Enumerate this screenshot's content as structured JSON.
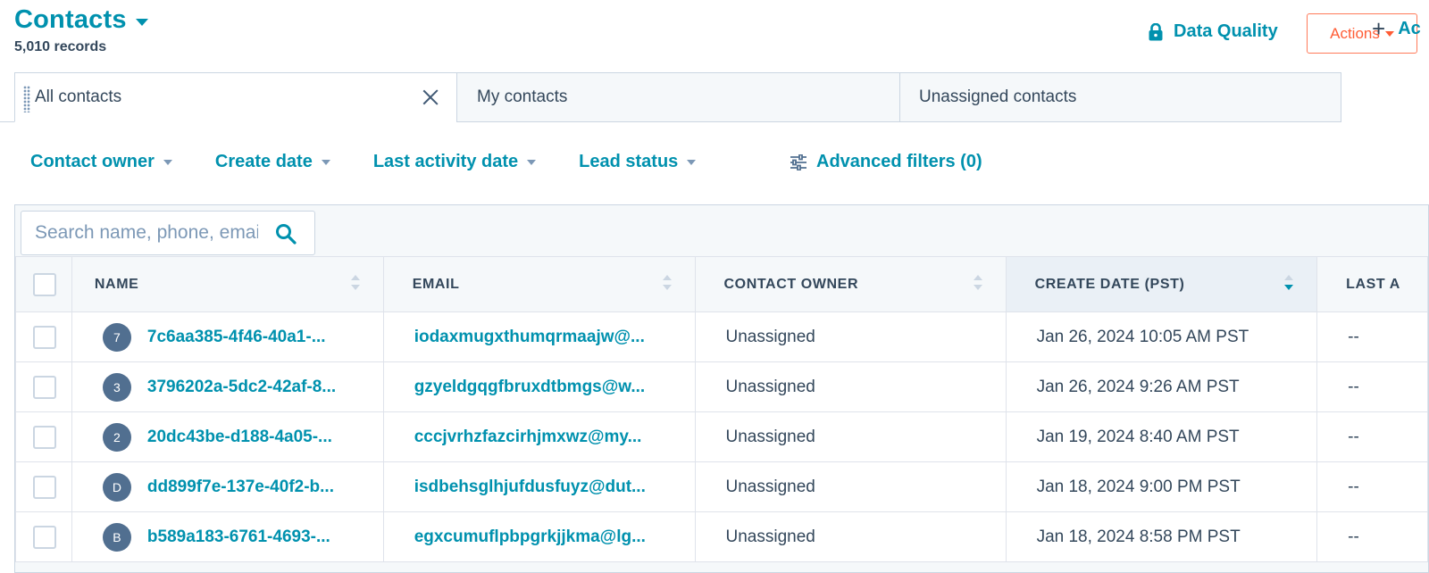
{
  "header": {
    "title": "Contacts",
    "record_count": "5,010 records",
    "data_quality_label": "Data Quality",
    "actions_label": "Actions"
  },
  "tabs": [
    {
      "label": "All contacts",
      "active": true
    },
    {
      "label": "My contacts",
      "active": false
    },
    {
      "label": "Unassigned contacts",
      "active": false
    }
  ],
  "add_view_label": "Ac",
  "filters": {
    "items": [
      "Contact owner",
      "Create date",
      "Last activity date",
      "Lead status"
    ],
    "advanced": "Advanced filters (0)"
  },
  "search": {
    "placeholder": "Search name, phone, email"
  },
  "table": {
    "columns": [
      "NAME",
      "EMAIL",
      "CONTACT OWNER",
      "CREATE DATE (PST)",
      "LAST A"
    ],
    "sorted_column": "CREATE DATE (PST)",
    "rows": [
      {
        "avatar": "7",
        "name": "7c6aa385-4f46-40a1-...",
        "email": "iodaxmugxthumqrmaajw@...",
        "owner": "Unassigned",
        "create_date": "Jan 26, 2024 10:05 AM PST",
        "last": "--"
      },
      {
        "avatar": "3",
        "name": "3796202a-5dc2-42af-8...",
        "email": "gzyeldgqgfbruxdtbmgs@w...",
        "owner": "Unassigned",
        "create_date": "Jan 26, 2024 9:26 AM PST",
        "last": "--"
      },
      {
        "avatar": "2",
        "name": "20dc43be-d188-4a05-...",
        "email": "cccjvrhzfazcirhjmxwz@my...",
        "owner": "Unassigned",
        "create_date": "Jan 19, 2024 8:40 AM PST",
        "last": "--"
      },
      {
        "avatar": "D",
        "name": "dd899f7e-137e-40f2-b...",
        "email": "isdbehsglhjufdusfuyz@dut...",
        "owner": "Unassigned",
        "create_date": "Jan 18, 2024 9:00 PM PST",
        "last": "--"
      },
      {
        "avatar": "B",
        "name": "b589a183-6761-4693-...",
        "email": "egxcumuflpbpgrkjjkma@lg...",
        "owner": "Unassigned",
        "create_date": "Jan 18, 2024 8:58 PM PST",
        "last": "--"
      }
    ]
  },
  "colors": {
    "brand_teal": "#0091ae",
    "actions_orange": "#ff5c35",
    "avatar_bg": "#516f90",
    "border": "#cbd6e2"
  },
  "icons": {
    "data_quality": "lock-icon",
    "search": "search-icon",
    "advanced_filters": "sliders-icon",
    "tab_close": "close-icon",
    "tab_grip": "drag-handle-icon",
    "add_view": "plus-icon"
  }
}
